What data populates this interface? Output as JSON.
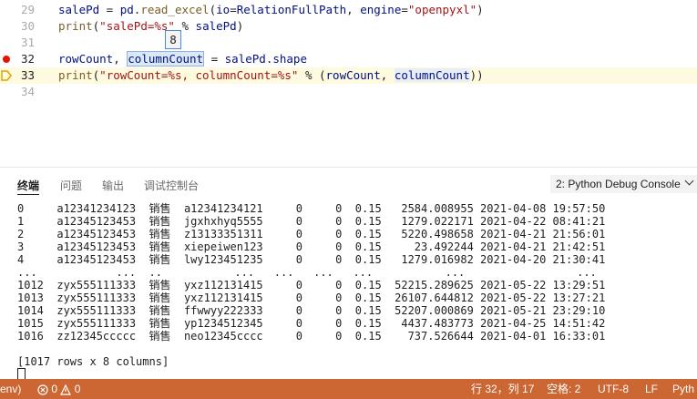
{
  "editor": {
    "lines": [
      {
        "num": "29",
        "segments": [
          {
            "t": "salePd",
            "c": "var"
          },
          {
            "t": " = ",
            "c": "plain"
          },
          {
            "t": "pd",
            "c": "var"
          },
          {
            "t": ".",
            "c": "plain"
          },
          {
            "t": "read_excel",
            "c": "fn"
          },
          {
            "t": "(",
            "c": "plain"
          },
          {
            "t": "io",
            "c": "var"
          },
          {
            "t": "=",
            "c": "plain"
          },
          {
            "t": "RelationFullPath",
            "c": "var"
          },
          {
            "t": ", ",
            "c": "plain"
          },
          {
            "t": "engine",
            "c": "var"
          },
          {
            "t": "=",
            "c": "plain"
          },
          {
            "t": "\"openpyxl\"",
            "c": "str"
          },
          {
            "t": ")",
            "c": "plain"
          }
        ]
      },
      {
        "num": "30",
        "segments": [
          {
            "t": "print",
            "c": "fn"
          },
          {
            "t": "(",
            "c": "plain"
          },
          {
            "t": "\"salePd=%s\"",
            "c": "str"
          },
          {
            "t": " % ",
            "c": "plain"
          },
          {
            "t": "salePd",
            "c": "var"
          },
          {
            "t": ")",
            "c": "plain"
          }
        ]
      },
      {
        "num": "31",
        "segments": []
      },
      {
        "num": "32",
        "breakpoint": true,
        "segments": [
          {
            "t": "rowCount",
            "c": "var"
          },
          {
            "t": ", ",
            "c": "plain"
          },
          {
            "t": "columnCount",
            "c": "var hl"
          },
          {
            "t": " = ",
            "c": "plain"
          },
          {
            "t": "salePd",
            "c": "var"
          },
          {
            "t": ".",
            "c": "plain"
          },
          {
            "t": "shape",
            "c": "var"
          }
        ]
      },
      {
        "num": "33",
        "current": true,
        "segments": [
          {
            "t": "print",
            "c": "fn"
          },
          {
            "t": "(",
            "c": "plain"
          },
          {
            "t": "\"rowCount=%s, columnCount=%s\"",
            "c": "str"
          },
          {
            "t": " % ",
            "c": "plain"
          },
          {
            "t": "(",
            "c": "plain"
          },
          {
            "t": "rowCount",
            "c": "var"
          },
          {
            "t": ", ",
            "c": "plain"
          },
          {
            "t": "columnCount",
            "c": "var hl-soft"
          },
          {
            "t": "))",
            "c": "plain"
          }
        ]
      },
      {
        "num": "34",
        "segments": []
      }
    ],
    "hover_value": "8"
  },
  "panel": {
    "tabs": [
      {
        "label": "终端",
        "active": true
      },
      {
        "label": "问题",
        "active": false
      },
      {
        "label": "输出",
        "active": false
      },
      {
        "label": "调试控制台",
        "active": false
      }
    ],
    "console_select": "2: Python Debug Console"
  },
  "terminal": {
    "lines": [
      "0     a12341234123  销售  a12341234121     0     0  0.15   2584.008955 2021-04-08 19:57:50",
      "1     a12345123453  销售  jgxhxhyq5555     0     0  0.15   1279.022171 2021-04-22 08:41:21",
      "2     a12345123453  销售  z13133351311     0     0  0.15   5220.498658 2021-04-21 21:56:01",
      "3     a12345123453  销售  xiepeiwen123     0     0  0.15     23.492244 2021-04-21 21:42:51",
      "4     a12345123453  销售  lwy123451235     0     0  0.15   1279.016982 2021-04-20 21:30:41",
      "...            ...  ..           ...   ...   ...   ...           ...                 ...",
      "1012  zyx555111333  销售  yxz112131415     0     0  0.15  52215.289625 2021-05-22 13:29:51",
      "1013  zyx555111333  销售  yxz112131415     0     0  0.15  26107.644812 2021-05-22 13:27:21",
      "1014  zyx555111333  销售  ffwwyy222333     0     0  0.15  52207.000869 2021-05-21 23:29:10",
      "1015  zyx555111333  销售  yp1234512345     0     0  0.15   4437.483773 2021-04-25 14:51:42",
      "1016  zz12345ccccc  销售  neo12345cccc     0     0  0.15    737.526644 2021-04-01 16:33:01",
      "",
      "[1017 rows x 8 columns]"
    ]
  },
  "statusbar": {
    "env": "env)",
    "errors": "0",
    "warnings": "0",
    "position": "行 32，列 17",
    "spaces": "空格: 2",
    "encoding": "UTF-8",
    "eol": "LF",
    "language": "Pyth"
  }
}
